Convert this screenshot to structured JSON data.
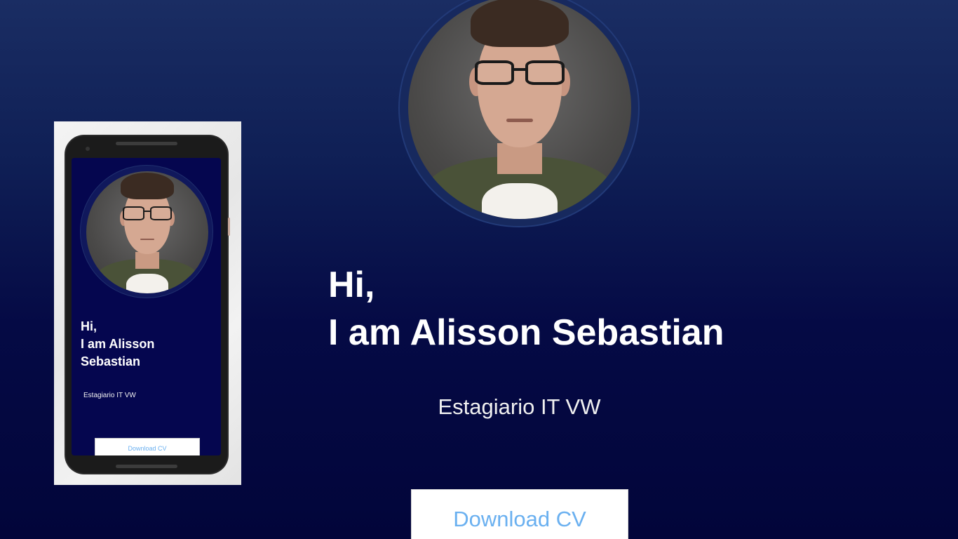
{
  "hero": {
    "greeting": "Hi,",
    "name_line": "I am Alisson Sebastian",
    "subtitle": "Estagiario IT VW",
    "download_label": "Download CV"
  },
  "phone_preview": {
    "greeting": "Hi,",
    "name_line_1": "I am Alisson",
    "name_line_2": "Sebastian",
    "subtitle": "Estagiario IT VW",
    "download_label": "Download CV"
  },
  "colors": {
    "background_top": "#1a2d63",
    "background_bottom": "#02053a",
    "button_text": "#6ab0f0",
    "button_bg": "#ffffff"
  }
}
